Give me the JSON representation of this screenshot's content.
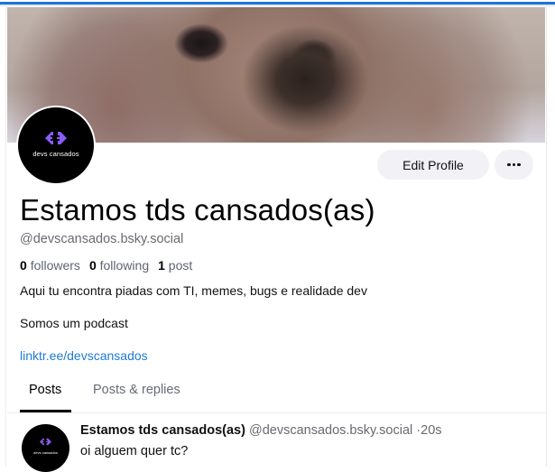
{
  "profile": {
    "avatar_label": "devs cansados",
    "display_name": "Estamos tds cansados(as)",
    "handle": "@devscansados.bsky.social",
    "stats": {
      "followers_count": "0",
      "followers_label": "followers",
      "following_count": "0",
      "following_label": "following",
      "posts_count": "1",
      "posts_label": "post"
    },
    "bio_line_1": "Aqui tu encontra piadas com TI, memes, bugs e realidade dev",
    "bio_line_2": "Somos um podcast",
    "link": "linktr.ee/devscansados",
    "accent_color": "#8b5cf6"
  },
  "actions": {
    "edit_profile_label": "Edit Profile",
    "more_icon": "more-horizontal-icon"
  },
  "tabs": [
    {
      "label": "Posts",
      "active": true
    },
    {
      "label": "Posts & replies",
      "active": false
    }
  ],
  "posts": [
    {
      "author_name": "Estamos tds cansados(as)",
      "author_handle": "@devscansados.bsky.social",
      "separator": "·",
      "time": "20s",
      "text": "oi alguem quer tc?",
      "avatar_label": "devs cansados"
    }
  ]
}
